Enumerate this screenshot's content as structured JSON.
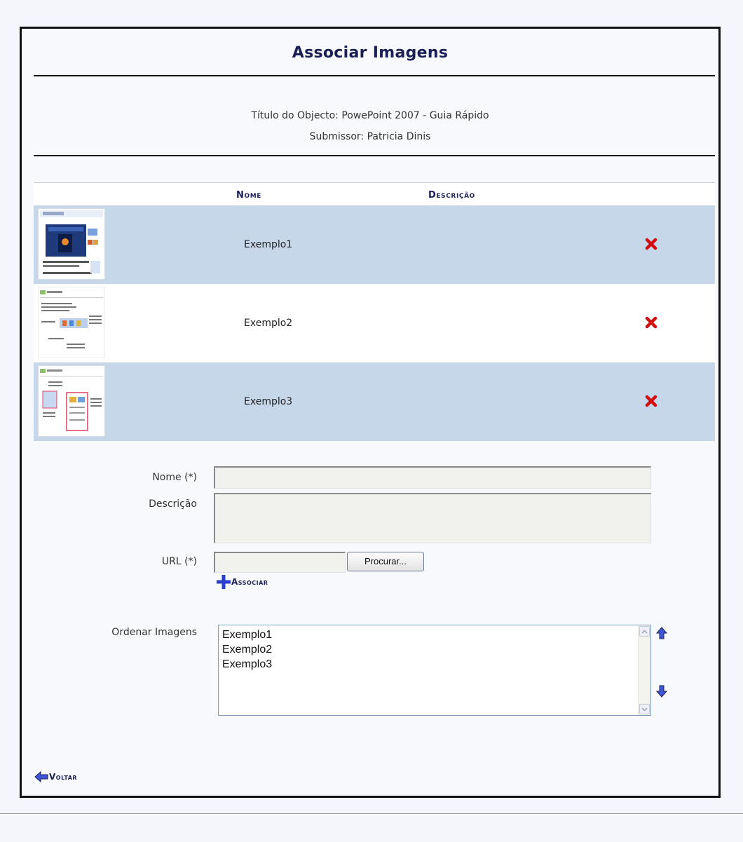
{
  "page": {
    "title": "Associar Imagens"
  },
  "object": {
    "title_line": "Título do Objecto: PowePoint 2007 - Guia Rápido",
    "submitter_line": "Submissor: Patricia Dinis"
  },
  "table": {
    "headers": {
      "name": "Nome",
      "description": "Descrição"
    },
    "rows": [
      {
        "name": "Exemplo1",
        "description": ""
      },
      {
        "name": "Exemplo2",
        "description": ""
      },
      {
        "name": "Exemplo3",
        "description": ""
      }
    ]
  },
  "form": {
    "name_label": "Nome (*)",
    "name_value": "",
    "description_label": "Descrição",
    "description_value": "",
    "url_label": "URL (*)",
    "url_value": "",
    "browse_label": "Procurar...",
    "associate_label": "Associar",
    "order_label": "Ordenar Imagens",
    "order_options": [
      "Exemplo1",
      "Exemplo2",
      "Exemplo3"
    ]
  },
  "nav": {
    "back_label": "Voltar"
  },
  "colors": {
    "accent": "#1a1f55",
    "row_alt": "#c6d7ea",
    "delete": "#d01010",
    "icon_blue": "#2a3fd0"
  }
}
